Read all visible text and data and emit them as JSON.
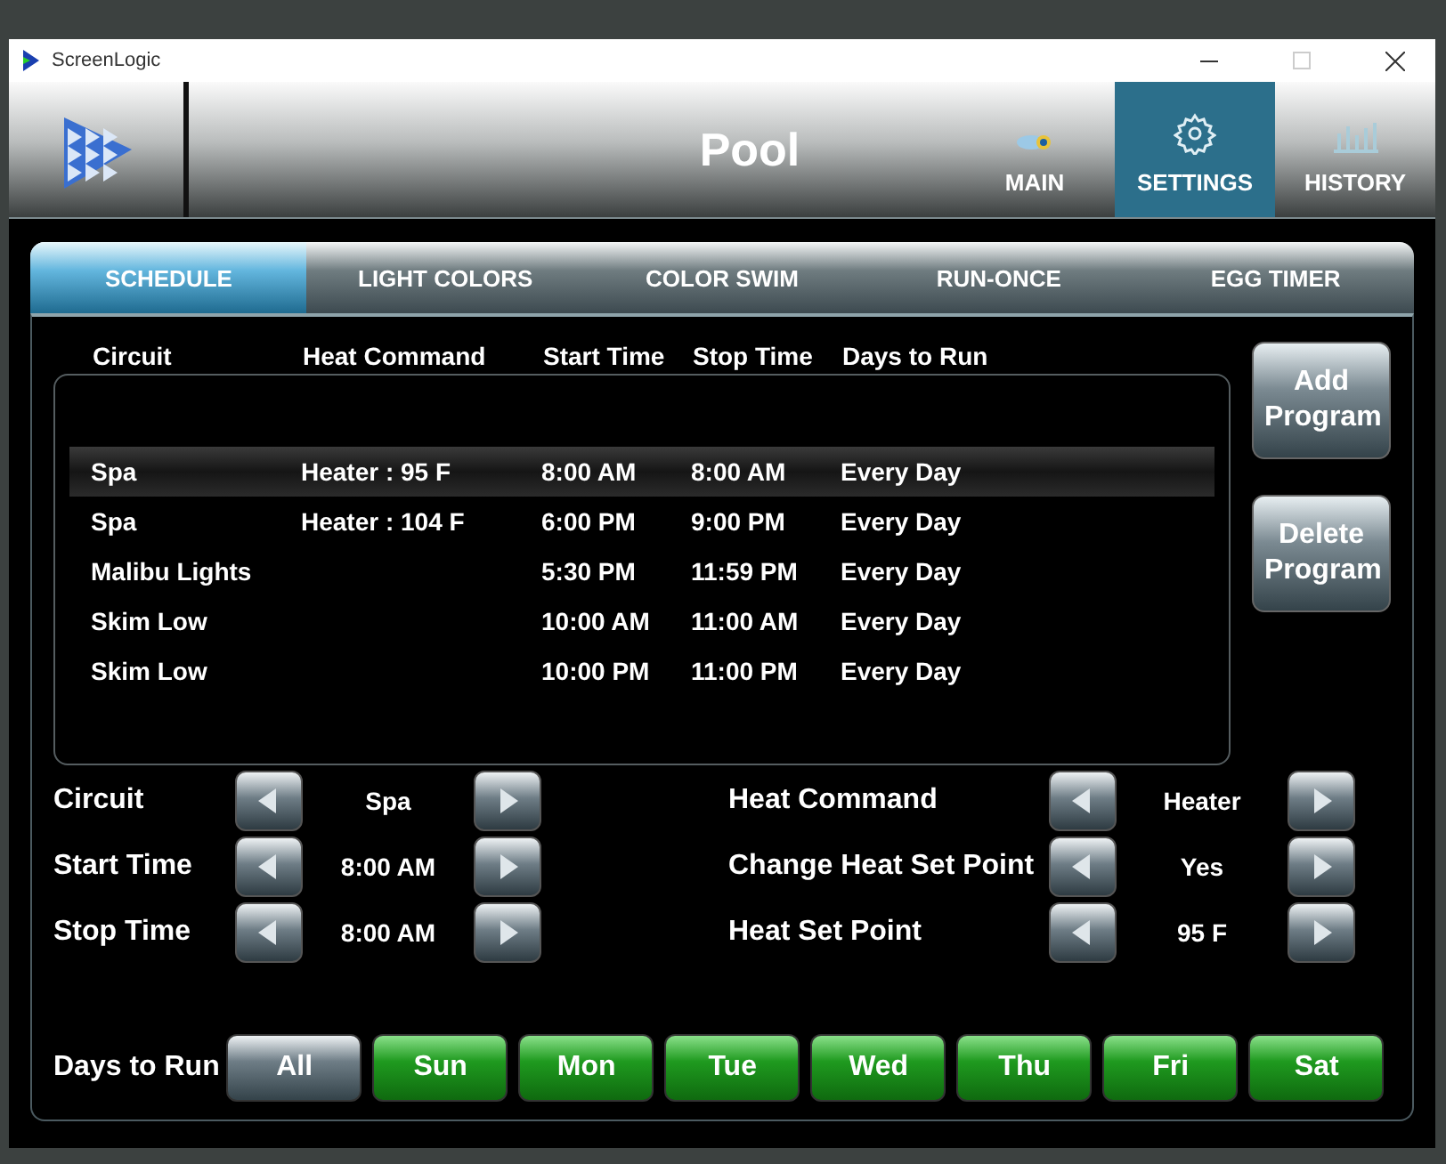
{
  "window": {
    "title": "ScreenLogic"
  },
  "header": {
    "title": "Pool",
    "nav": [
      {
        "label": "MAIN",
        "kind": "main",
        "selected": false
      },
      {
        "label": "SETTINGS",
        "kind": "settings",
        "selected": true
      },
      {
        "label": "HISTORY",
        "kind": "history",
        "selected": false
      }
    ]
  },
  "tabs": [
    {
      "label": "SCHEDULE",
      "selected": true
    },
    {
      "label": "LIGHT COLORS",
      "selected": false
    },
    {
      "label": "COLOR SWIM",
      "selected": false
    },
    {
      "label": "RUN-ONCE",
      "selected": false
    },
    {
      "label": "EGG TIMER",
      "selected": false
    }
  ],
  "table": {
    "columns": [
      "Circuit",
      "Heat Command",
      "Start Time",
      "Stop Time",
      "Days to Run"
    ],
    "rows": [
      {
        "cells": [
          "Spa",
          "Heater : 95 F",
          "8:00  AM",
          "8:00  AM",
          "Every Day"
        ],
        "selected": true
      },
      {
        "cells": [
          "Spa",
          "Heater : 104 F",
          "6:00  PM",
          "9:00  PM",
          "Every Day"
        ],
        "selected": false
      },
      {
        "cells": [
          "Malibu Lights",
          "",
          "5:30  PM",
          "11:59  PM",
          "Every Day"
        ],
        "selected": false
      },
      {
        "cells": [
          "Skim Low",
          "",
          "10:00  AM",
          "11:00  AM",
          "Every Day"
        ],
        "selected": false
      },
      {
        "cells": [
          "Skim Low",
          "",
          "10:00  PM",
          "11:00  PM",
          "Every Day"
        ],
        "selected": false
      }
    ]
  },
  "actions": [
    "Add Program",
    "Delete Program"
  ],
  "editor_left": [
    {
      "label": "Circuit",
      "value": "Spa"
    },
    {
      "label": "Start Time",
      "value": "8:00  AM"
    },
    {
      "label": "Stop Time",
      "value": "8:00  AM"
    }
  ],
  "editor_right": [
    {
      "label": "Heat Command",
      "value": "Heater"
    },
    {
      "label": "Change Heat Set Point",
      "value": "Yes"
    },
    {
      "label": "Heat Set Point",
      "value": "95 F"
    }
  ],
  "days": {
    "label": "Days to Run",
    "items": [
      {
        "label": "All",
        "selected": false
      },
      {
        "label": "Sun",
        "selected": true
      },
      {
        "label": "Mon",
        "selected": true
      },
      {
        "label": "Tue",
        "selected": true
      },
      {
        "label": "Wed",
        "selected": true
      },
      {
        "label": "Thu",
        "selected": true
      },
      {
        "label": "Fri",
        "selected": true
      },
      {
        "label": "Sat",
        "selected": true
      }
    ]
  }
}
